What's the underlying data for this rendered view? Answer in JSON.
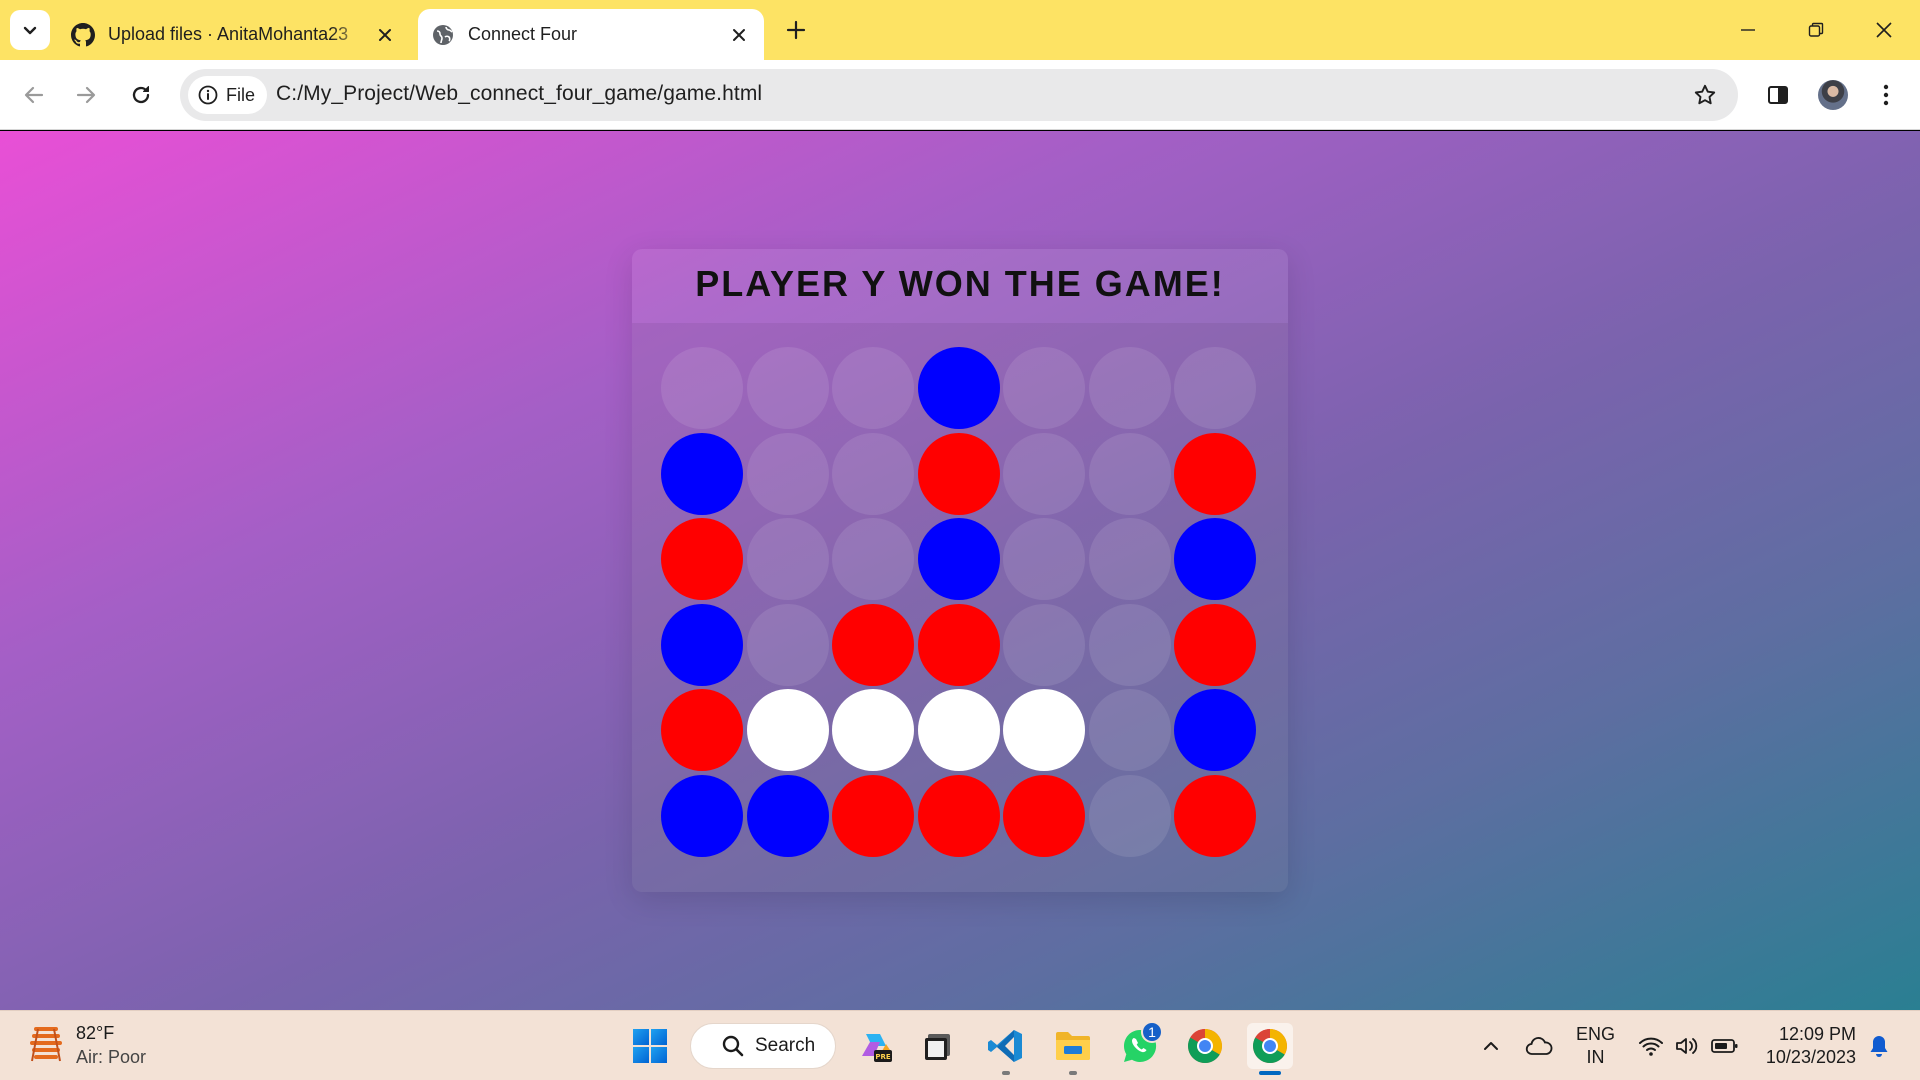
{
  "browser": {
    "tabs": [
      {
        "title": "Upload files · AnitaMohanta23",
        "active": false,
        "icon": "github-icon"
      },
      {
        "title": "Connect Four",
        "active": true,
        "icon": "globe-icon"
      }
    ],
    "address": {
      "chip_label": "File",
      "url": "C:/My_Project/Web_connect_four_game/game.html"
    }
  },
  "game": {
    "status": "PLAYER Y WON THE GAME!",
    "columns": 7,
    "rows": 6,
    "colors": {
      "R": "#ff0000",
      "Y": "#0000ff",
      "W": "#ffffff",
      "empty": "rgba(255,255,255,0.10)"
    },
    "board": [
      [
        "",
        "",
        "",
        "Y",
        "",
        "",
        ""
      ],
      [
        "Y",
        "",
        "",
        "R",
        "",
        "",
        "R"
      ],
      [
        "R",
        "",
        "",
        "Y",
        "",
        "",
        "Y"
      ],
      [
        "Y",
        "",
        "R",
        "R",
        "",
        "",
        "R"
      ],
      [
        "R",
        "W",
        "W",
        "W",
        "W",
        "",
        "Y"
      ],
      [
        "Y",
        "Y",
        "R",
        "R",
        "R",
        "",
        "R"
      ]
    ]
  },
  "taskbar": {
    "weather": {
      "temp": "82°F",
      "air": "Air: Poor"
    },
    "search_label": "Search",
    "whatsapp_badge": "1",
    "language": {
      "line1": "ENG",
      "line2": "IN"
    },
    "clock": {
      "time": "12:09 PM",
      "date": "10/23/2023"
    }
  }
}
